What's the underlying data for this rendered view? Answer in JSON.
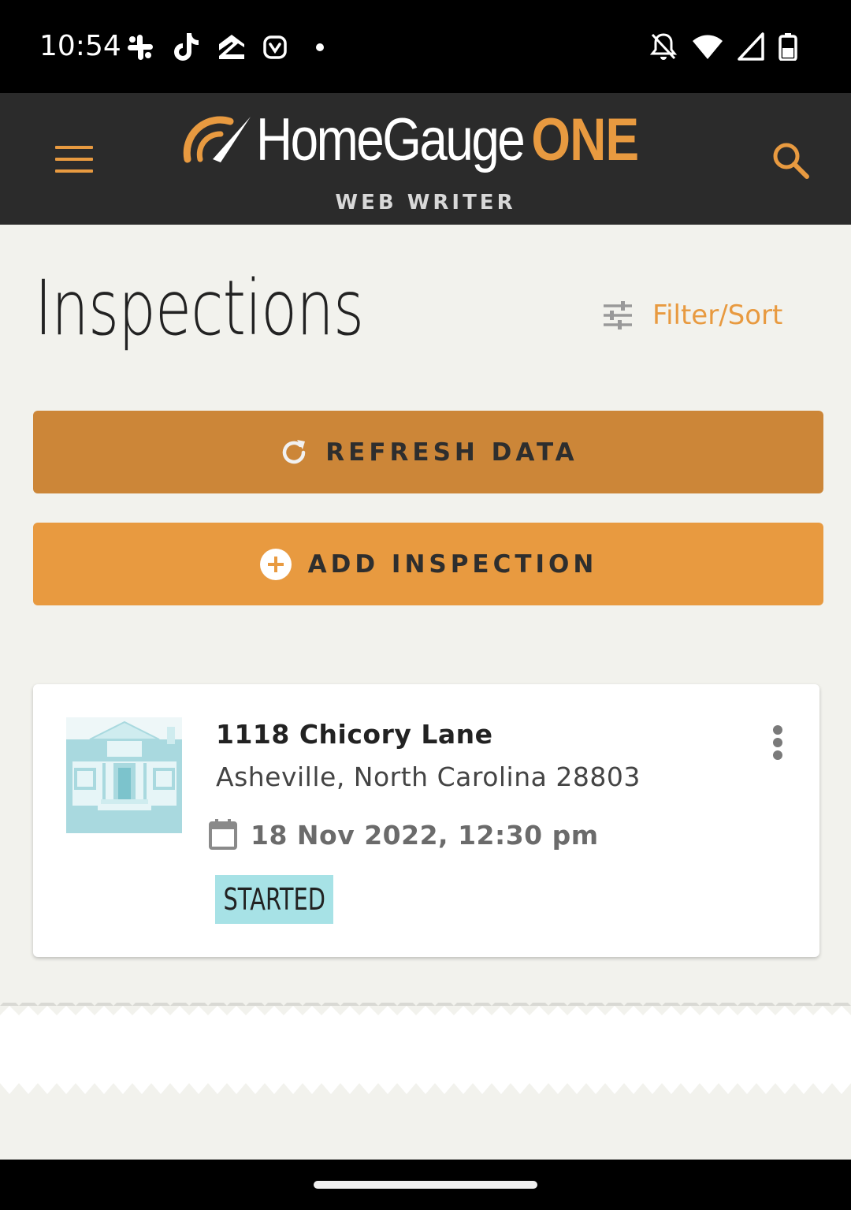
{
  "status_bar": {
    "time": "10:54",
    "left_icons": [
      "slack-icon",
      "tiktok-icon",
      "zillow-icon",
      "app-icon",
      "dot-icon"
    ],
    "right_icons": [
      "bell-off-icon",
      "wifi-icon",
      "signal-icon",
      "battery-icon"
    ]
  },
  "header": {
    "brand_name": "HomeGauge",
    "brand_suffix": "ONE",
    "subtitle": "WEB WRITER",
    "accent_color": "#e89a40",
    "background_color": "#2b2b2b"
  },
  "page": {
    "title": "Inspections",
    "filter_sort_label": "Filter/Sort"
  },
  "actions": {
    "refresh_label": "REFRESH DATA",
    "add_label": "ADD INSPECTION"
  },
  "inspections": [
    {
      "address": "1118 Chicory Lane",
      "city_line": "Asheville, North Carolina 28803",
      "datetime": "18 Nov 2022, 12:30 pm",
      "status": "STARTED",
      "status_color": "#a7e2e6"
    }
  ]
}
